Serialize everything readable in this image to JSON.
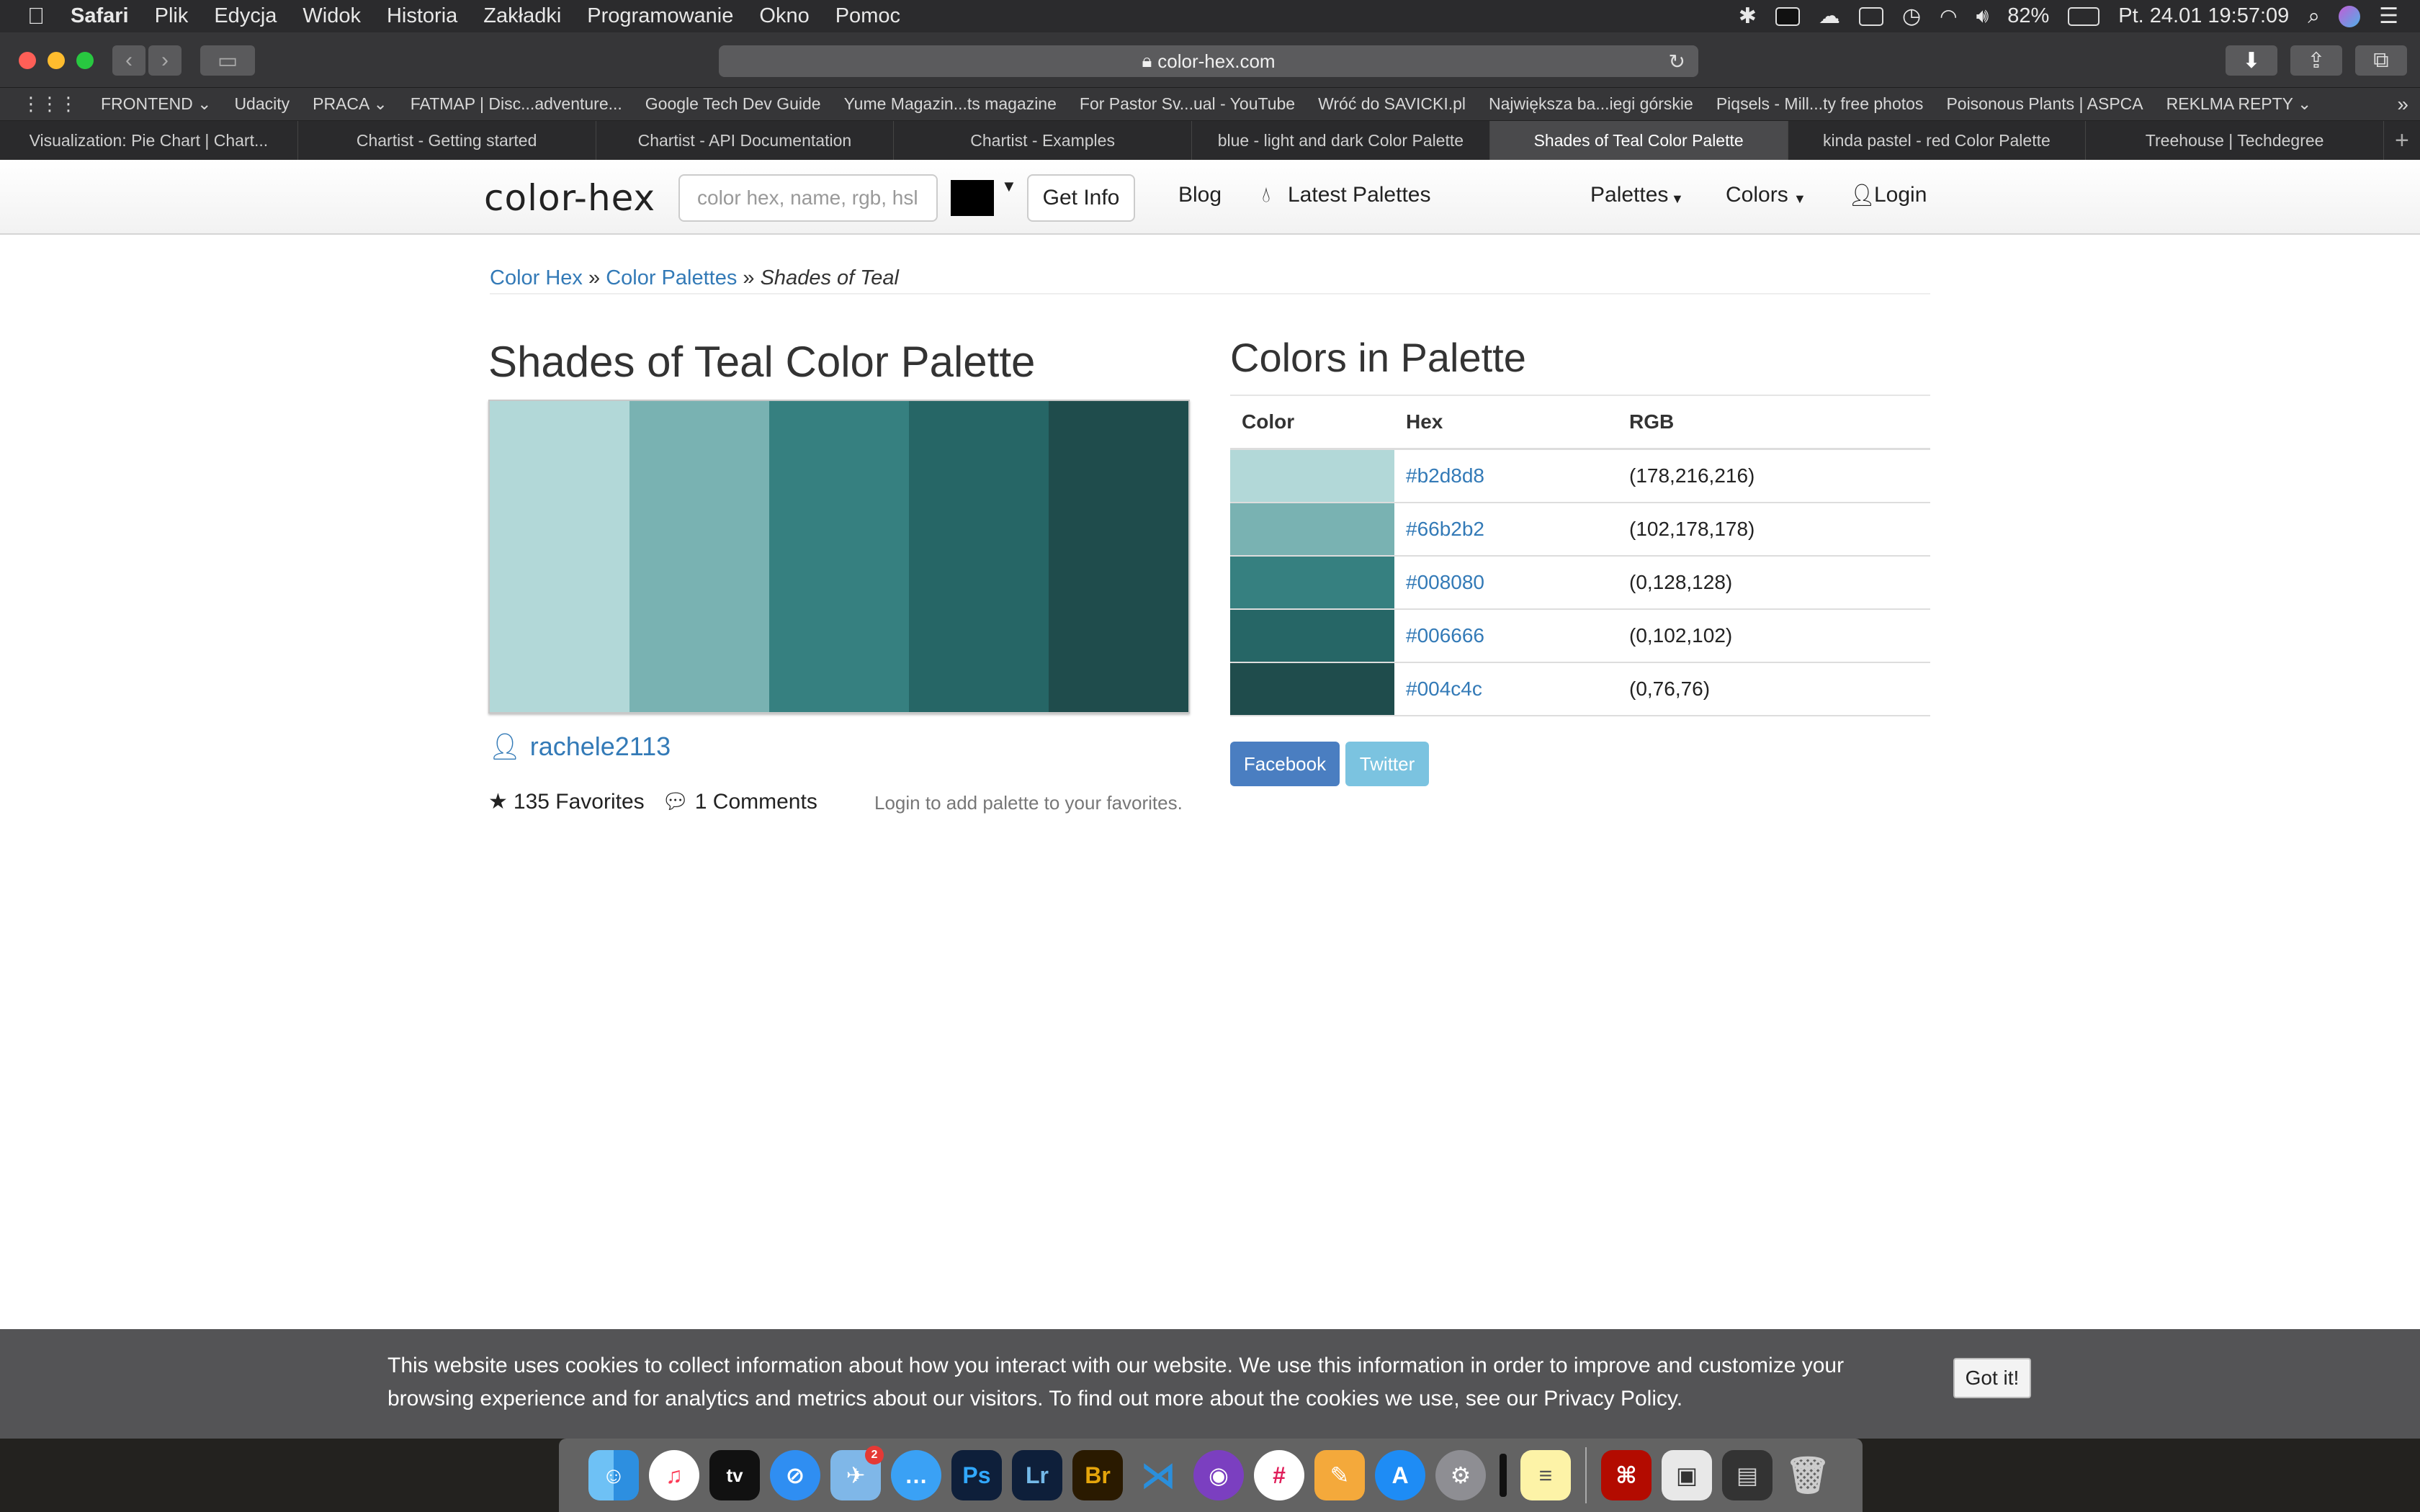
{
  "menubar": {
    "items": [
      "Safari",
      "Plik",
      "Edycja",
      "Widok",
      "Historia",
      "Zakładki",
      "Programowanie",
      "Okno",
      "Pomoc"
    ],
    "battery": "82%",
    "datetime": "Pt. 24.01  19:57:09"
  },
  "browser": {
    "url": "color-hex.com",
    "bookmarks": [
      "FRONTEND ⌄",
      "Udacity",
      "PRACA ⌄",
      "FATMAP | Disc...adventure...",
      "Google Tech Dev Guide",
      "Yume Magazin...ts magazine",
      "For Pastor Sv...ual - YouTube",
      "Wróć do SAVICKI.pl",
      "Największa ba...iegi górskie",
      "Piqsels - Mill...ty free photos",
      "Poisonous Plants | ASPCA",
      "REKLMA REPTY ⌄"
    ],
    "tabs": [
      "Visualization: Pie Chart  |  Chart...",
      "Chartist - Getting started",
      "Chartist - API Documentation",
      "Chartist - Examples",
      "blue - light and dark Color Palette",
      "Shades of Teal Color Palette",
      "kinda pastel - red Color Palette",
      "Treehouse | Techdegree"
    ],
    "active_tab_index": 5
  },
  "sitenav": {
    "logo": "color-hex",
    "search_placeholder": "color hex, name, rgb, hsl",
    "getinfo": "Get Info",
    "blog": "Blog",
    "latest": "Latest Palettes",
    "palettes": "Palettes",
    "colors": "Colors",
    "login": "Login"
  },
  "breadcrumb": {
    "home": "Color Hex",
    "sep1": " » ",
    "palettes": "Color Palettes",
    "sep2": " » ",
    "current": "Shades of Teal"
  },
  "palette": {
    "title": "Shades of Teal Color Palette",
    "author": "rachele2113",
    "favorites": "135 Favorites",
    "comments": "1 Comments",
    "login_note": "Login to add palette to your favorites."
  },
  "colors_section": {
    "title": "Colors in Palette",
    "headers": [
      "Color",
      "Hex",
      "RGB"
    ],
    "rows": [
      {
        "hex": "#b2d8d8",
        "rgb": "(178,216,216)"
      },
      {
        "hex": "#66b2b2",
        "rgb": "(102,178,178)"
      },
      {
        "hex": "#008080",
        "rgb": "(0,128,128)"
      },
      {
        "hex": "#006666",
        "rgb": "(0,102,102)"
      },
      {
        "hex": "#004c4c",
        "rgb": "(0,76,76)"
      }
    ],
    "facebook": "Facebook",
    "twitter": "Twitter"
  },
  "cookie": {
    "text": "This website uses cookies to collect information about how you interact with our website. We use this information in order to improve and customize your browsing experience and for analytics and metrics about our visitors. To find out more about the cookies we use, see our Privacy Policy.",
    "button": "Got it!"
  },
  "dock": {
    "icons": [
      "finder-icon",
      "music-icon",
      "tv-icon",
      "safari-icon",
      "mail-icon",
      "messages-icon",
      "photoshop-icon",
      "lightroom-icon",
      "bridge-icon",
      "vscode-icon",
      "github-icon",
      "slack-icon",
      "pages-icon",
      "appstore-icon",
      "settings-icon",
      "remote-icon",
      "notes-icon",
      "acrobat-icon",
      "preview-icon",
      "activity-icon",
      "trash-icon"
    ],
    "mail_badge": "2",
    "labels": {
      "ps": "Ps",
      "lr": "Lr",
      "br": "Br",
      "tv": "tv"
    }
  },
  "colors": {
    "accent": "#337ab7",
    "facebook": "#4a7ec1",
    "twitter": "#7bc3e0",
    "cookie_bg": "#545456"
  }
}
